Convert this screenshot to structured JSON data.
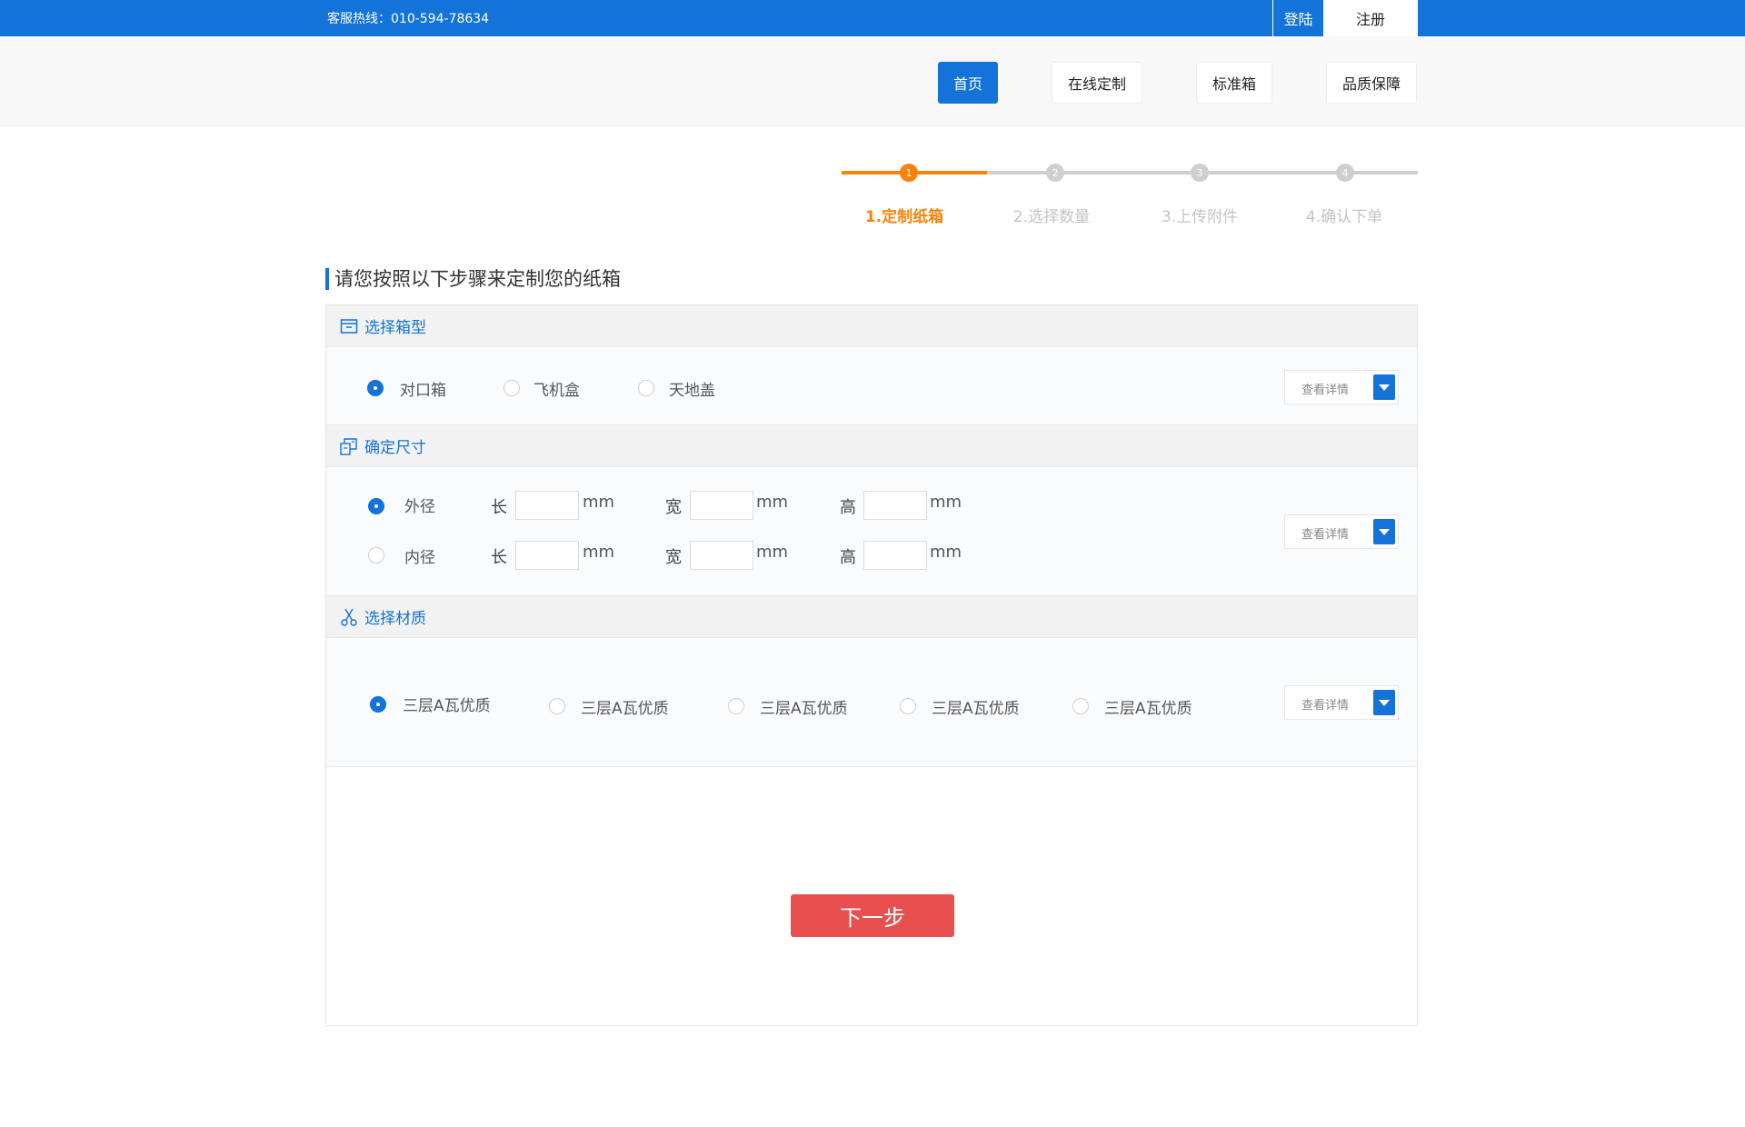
{
  "topbar": {
    "hotline": "客服热线：010-594-78634",
    "login": "登陆",
    "register": "注册"
  },
  "nav": {
    "items": [
      "首页",
      "在线定制",
      "标准箱",
      "品质保障"
    ]
  },
  "steps": {
    "nums": [
      "1",
      "2",
      "3",
      "4"
    ],
    "labels": [
      "1.定制纸箱",
      "2.选择数量",
      "3.上传附件",
      "4.确认下单"
    ],
    "current": 1
  },
  "heading": "请您按照以下步骤来定制您的纸箱",
  "box_type": {
    "title": "选择箱型",
    "options": [
      "对口箱",
      "飞机盒",
      "天地盖"
    ],
    "selected": "对口箱",
    "detail": "查看详情"
  },
  "size": {
    "title": "确定尺寸",
    "rows": [
      {
        "label": "外径",
        "selected": true
      },
      {
        "label": "内径",
        "selected": false
      }
    ],
    "dims": [
      "长",
      "宽",
      "高"
    ],
    "unit": "mm",
    "detail": "查看详情"
  },
  "material": {
    "title": "选择材质",
    "options": [
      "三层A瓦优质",
      "三层A瓦优质",
      "三层A瓦优质",
      "三层A瓦优质",
      "三层A瓦优质"
    ],
    "selected_index": 0,
    "detail": "查看详情"
  },
  "next": "下一步",
  "colors": {
    "primary": "#1373d9",
    "step_active": "#f7830b",
    "next_button": "#e8504f"
  }
}
